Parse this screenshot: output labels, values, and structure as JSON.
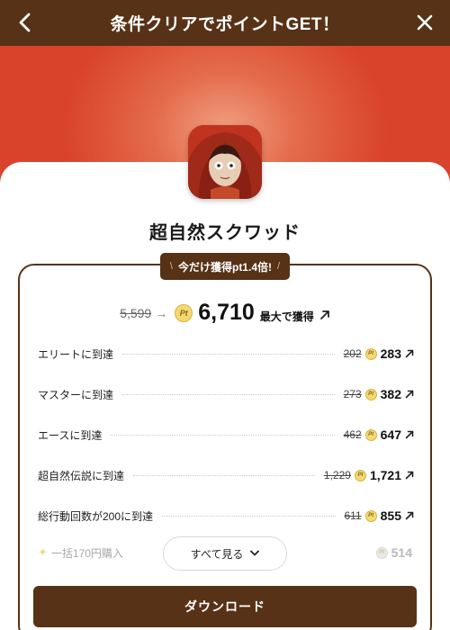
{
  "header": {
    "title": "条件クリアでポイントGET！",
    "back_icon": "chevron-left-icon",
    "close_icon": "close-icon"
  },
  "colors": {
    "brand_brown": "#573216",
    "hero_red": "#d9432b",
    "coin_gold": "#f3d874"
  },
  "app": {
    "name": "超自然スクワッド"
  },
  "badge": {
    "slash_left": "\\",
    "text": "今だけ獲得pt1.4倍!",
    "slash_right": "/"
  },
  "summary": {
    "old_points": "5,599",
    "arrow": "→",
    "coin_label": "Pt",
    "new_points": "6,710",
    "max_label": "最大で獲得"
  },
  "tasks": [
    {
      "label": "エリートに到達",
      "old": "202",
      "coin": "Pt",
      "new": "283"
    },
    {
      "label": "マスターに到達",
      "old": "273",
      "coin": "Pt",
      "new": "382"
    },
    {
      "label": "エースに到達",
      "old": "462",
      "coin": "Pt",
      "new": "647"
    },
    {
      "label": "超自然伝説に到達",
      "old": "1,229",
      "coin": "Pt",
      "new": "1,721"
    },
    {
      "label": "総行動回数が200に到達",
      "old": "611",
      "coin": "Pt",
      "new": "855"
    }
  ],
  "faded_task": {
    "label": "一括170円購入",
    "coin": "Pt",
    "new": "514"
  },
  "see_all": {
    "label": "すべて見る"
  },
  "download": {
    "label": "ダウンロード"
  }
}
